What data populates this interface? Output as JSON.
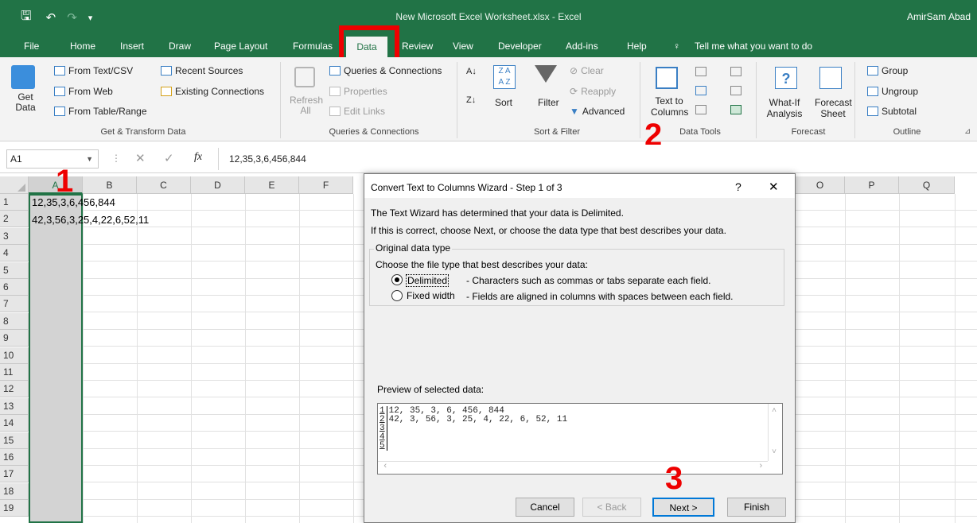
{
  "titlebar": {
    "document_title": "New Microsoft Excel Worksheet.xlsx  -  Excel",
    "user": "AmirSam Abad"
  },
  "menu": [
    "File",
    "Home",
    "Insert",
    "Draw",
    "Page Layout",
    "Formulas",
    "Data",
    "Review",
    "View",
    "Developer",
    "Add-ins",
    "Help"
  ],
  "tell_me": "Tell me what you want to do",
  "ribbon": {
    "get_data": "Get Data",
    "from_text_csv": "From Text/CSV",
    "from_web": "From Web",
    "from_table_range": "From Table/Range",
    "recent_sources": "Recent Sources",
    "existing_connections": "Existing Connections",
    "group_get_transform": "Get & Transform Data",
    "refresh_all": "Refresh All",
    "queries_connections": "Queries & Connections",
    "properties": "Properties",
    "edit_links": "Edit Links",
    "group_queries": "Queries & Connections",
    "sort": "Sort",
    "filter": "Filter",
    "clear": "Clear",
    "reapply": "Reapply",
    "advanced": "Advanced",
    "group_sort_filter": "Sort & Filter",
    "text_to_columns": "Text to Columns",
    "group_data_tools": "Data Tools",
    "what_if": "What-If Analysis",
    "forecast_sheet": "Forecast Sheet",
    "group_forecast": "Forecast",
    "group": "Group",
    "ungroup": "Ungroup",
    "subtotal": "Subtotal",
    "group_outline": "Outline"
  },
  "formula_bar": {
    "name_box": "A1",
    "fx": "fx",
    "content": "12,35,3,6,456,844"
  },
  "columns_left": [
    "A",
    "B",
    "C",
    "D",
    "E",
    "F"
  ],
  "columns_right": [
    "O",
    "P",
    "Q"
  ],
  "rows": [
    "1",
    "2",
    "3",
    "4",
    "5",
    "6",
    "7",
    "8",
    "9",
    "10",
    "11",
    "12",
    "13",
    "14",
    "15",
    "16",
    "17",
    "18",
    "19"
  ],
  "cells": {
    "a1": "12,35,3,6,456,844",
    "a2": "42,3,56,3,25,4,22,6,52,11"
  },
  "annotations": {
    "one": "1",
    "two": "2",
    "three": "3"
  },
  "dialog": {
    "title": "Convert Text to Columns Wizard - Step 1 of 3",
    "help": "?",
    "close": "✕",
    "line1": "The Text Wizard has determined that your data is Delimited.",
    "line2": "If this is correct, choose Next, or choose the data type that best describes your data.",
    "fieldset_label": "Original data type",
    "choose_label": "Choose the file type that best describes your data:",
    "delimited_label": "Delimited",
    "delimited_desc": "- Characters such as commas or tabs separate each field.",
    "fixed_label": "Fixed width",
    "fixed_desc": "- Fields are aligned in columns with spaces between each field.",
    "preview_label": "Preview of selected data:",
    "preview_lines": [
      {
        "n": "1",
        "text": "12, 35, 3, 6, 456, 844"
      },
      {
        "n": "2",
        "text": "42, 3, 56, 3, 25, 4, 22, 6, 52, 11"
      },
      {
        "n": "3",
        "text": ""
      },
      {
        "n": "4",
        "text": ""
      },
      {
        "n": "5",
        "text": ""
      }
    ],
    "buttons": {
      "cancel": "Cancel",
      "back": "< Back",
      "next": "Next >",
      "finish": "Finish"
    }
  }
}
